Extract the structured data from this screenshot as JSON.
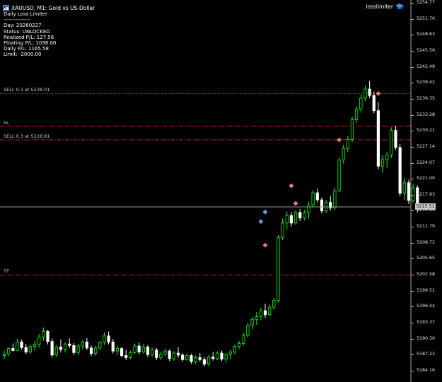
{
  "header": {
    "title": "XAUUSD, M1:  Gold vs US-Dollar",
    "ea_name": "losslimiter"
  },
  "info_panel": {
    "lines": [
      "Daily Loss Limiter",
      "---------------",
      "Day: 20260227",
      "Status: UNLOCKED",
      "Realized P/L: 127.58",
      "Floating P/L: 1038.00",
      "Daily P/L: 1165.58",
      "Limit: -2000.00"
    ]
  },
  "levels": [
    {
      "name": "sell-order-1",
      "label": "SELL 0.3 at 5238.01",
      "price": 5238.01,
      "color": "#2e8b2e",
      "style": "dotted"
    },
    {
      "name": "stop-loss",
      "label": "SL",
      "price": 5231.5,
      "color": "#cc2222",
      "style": "dashdot"
    },
    {
      "name": "sell-order-2",
      "label": "SELL 0.3 at 5228.81",
      "price": 5228.81,
      "color": "#cc2222",
      "style": "dashdot"
    },
    {
      "name": "take-profit",
      "label": "TP",
      "price": 5202.0,
      "color": "#cc2222",
      "style": "dashdot"
    }
  ],
  "bid_line": {
    "price": 5215.51,
    "label": "5215.51"
  },
  "price_axis": {
    "ticks": [
      "5254.77",
      "5251.70",
      "5248.63",
      "5245.56",
      "5242.49",
      "5239.42",
      "5236.35",
      "5233.28",
      "5230.21",
      "5227.14",
      "5224.07",
      "5221.00",
      "5217.93",
      "5214.86",
      "5211.79",
      "5208.72",
      "5205.65",
      "5202.58",
      "5199.51",
      "5196.44",
      "5193.37",
      "5190.30",
      "5187.23",
      "5184.16"
    ]
  },
  "colors": {
    "background": "#000000",
    "bull": "#00ff00",
    "bear": "#ffffff",
    "sell_marker": "#ff6060",
    "buy_marker": "#4a90ff"
  },
  "chart_data": {
    "type": "candlestick",
    "ylim": [
      5183.0,
      5256.0
    ],
    "candles": [
      {
        "o": 5186.0,
        "h": 5187.0,
        "l": 5185.3,
        "c": 5186.3
      },
      {
        "o": 5186.3,
        "h": 5187.6,
        "l": 5185.9,
        "c": 5187.4
      },
      {
        "o": 5187.4,
        "h": 5188.4,
        "l": 5186.8,
        "c": 5187.0
      },
      {
        "o": 5187.0,
        "h": 5189.3,
        "l": 5186.9,
        "c": 5188.7
      },
      {
        "o": 5188.7,
        "h": 5189.2,
        "l": 5187.2,
        "c": 5187.6
      },
      {
        "o": 5187.6,
        "h": 5188.3,
        "l": 5186.3,
        "c": 5186.7
      },
      {
        "o": 5186.7,
        "h": 5188.1,
        "l": 5186.4,
        "c": 5187.8
      },
      {
        "o": 5187.8,
        "h": 5188.9,
        "l": 5187.0,
        "c": 5188.2
      },
      {
        "o": 5188.2,
        "h": 5190.3,
        "l": 5187.6,
        "c": 5189.7
      },
      {
        "o": 5189.7,
        "h": 5191.6,
        "l": 5188.9,
        "c": 5190.8
      },
      {
        "o": 5190.8,
        "h": 5191.1,
        "l": 5188.2,
        "c": 5188.8
      },
      {
        "o": 5188.8,
        "h": 5189.4,
        "l": 5185.6,
        "c": 5186.1
      },
      {
        "o": 5186.1,
        "h": 5188.1,
        "l": 5185.7,
        "c": 5187.7
      },
      {
        "o": 5187.7,
        "h": 5189.2,
        "l": 5186.6,
        "c": 5187.2
      },
      {
        "o": 5187.2,
        "h": 5188.6,
        "l": 5186.6,
        "c": 5188.3
      },
      {
        "o": 5188.3,
        "h": 5189.4,
        "l": 5187.5,
        "c": 5188.0
      },
      {
        "o": 5188.0,
        "h": 5188.5,
        "l": 5186.1,
        "c": 5186.6
      },
      {
        "o": 5186.6,
        "h": 5188.3,
        "l": 5186.0,
        "c": 5187.9
      },
      {
        "o": 5187.9,
        "h": 5189.1,
        "l": 5187.3,
        "c": 5188.7
      },
      {
        "o": 5188.7,
        "h": 5189.5,
        "l": 5187.1,
        "c": 5187.5
      },
      {
        "o": 5187.5,
        "h": 5188.0,
        "l": 5185.9,
        "c": 5186.4
      },
      {
        "o": 5186.4,
        "h": 5187.9,
        "l": 5186.0,
        "c": 5187.5
      },
      {
        "o": 5187.5,
        "h": 5188.9,
        "l": 5187.2,
        "c": 5188.6
      },
      {
        "o": 5188.6,
        "h": 5190.6,
        "l": 5188.1,
        "c": 5189.9
      },
      {
        "o": 5189.9,
        "h": 5190.8,
        "l": 5188.2,
        "c": 5188.7
      },
      {
        "o": 5188.7,
        "h": 5189.3,
        "l": 5186.4,
        "c": 5186.9
      },
      {
        "o": 5186.9,
        "h": 5188.0,
        "l": 5186.1,
        "c": 5187.4
      },
      {
        "o": 5187.4,
        "h": 5187.7,
        "l": 5185.6,
        "c": 5186.0
      },
      {
        "o": 5186.0,
        "h": 5187.2,
        "l": 5185.1,
        "c": 5185.6
      },
      {
        "o": 5185.6,
        "h": 5187.0,
        "l": 5185.3,
        "c": 5186.6
      },
      {
        "o": 5186.6,
        "h": 5188.4,
        "l": 5186.3,
        "c": 5187.9
      },
      {
        "o": 5187.9,
        "h": 5188.6,
        "l": 5186.2,
        "c": 5186.7
      },
      {
        "o": 5186.7,
        "h": 5188.3,
        "l": 5186.4,
        "c": 5187.7
      },
      {
        "o": 5187.7,
        "h": 5188.1,
        "l": 5185.7,
        "c": 5186.2
      },
      {
        "o": 5186.2,
        "h": 5187.6,
        "l": 5185.8,
        "c": 5187.1
      },
      {
        "o": 5187.1,
        "h": 5187.5,
        "l": 5185.1,
        "c": 5185.6
      },
      {
        "o": 5185.6,
        "h": 5186.8,
        "l": 5185.1,
        "c": 5186.3
      },
      {
        "o": 5186.3,
        "h": 5187.4,
        "l": 5185.9,
        "c": 5186.9
      },
      {
        "o": 5186.9,
        "h": 5187.3,
        "l": 5184.9,
        "c": 5185.4
      },
      {
        "o": 5185.4,
        "h": 5186.9,
        "l": 5185.0,
        "c": 5186.5
      },
      {
        "o": 5186.5,
        "h": 5187.7,
        "l": 5185.6,
        "c": 5186.1
      },
      {
        "o": 5186.1,
        "h": 5186.5,
        "l": 5184.8,
        "c": 5185.2
      },
      {
        "o": 5185.2,
        "h": 5186.3,
        "l": 5184.9,
        "c": 5186.0
      },
      {
        "o": 5186.0,
        "h": 5186.4,
        "l": 5184.3,
        "c": 5184.8
      },
      {
        "o": 5184.8,
        "h": 5186.0,
        "l": 5184.3,
        "c": 5185.6
      },
      {
        "o": 5185.6,
        "h": 5186.5,
        "l": 5184.8,
        "c": 5185.2
      },
      {
        "o": 5185.2,
        "h": 5185.7,
        "l": 5183.8,
        "c": 5184.3
      },
      {
        "o": 5184.3,
        "h": 5186.1,
        "l": 5183.9,
        "c": 5185.7
      },
      {
        "o": 5185.7,
        "h": 5186.7,
        "l": 5185.0,
        "c": 5185.4
      },
      {
        "o": 5185.4,
        "h": 5186.9,
        "l": 5185.1,
        "c": 5186.5
      },
      {
        "o": 5186.5,
        "h": 5187.0,
        "l": 5184.9,
        "c": 5185.3
      },
      {
        "o": 5185.3,
        "h": 5186.6,
        "l": 5184.6,
        "c": 5186.2
      },
      {
        "o": 5186.2,
        "h": 5187.1,
        "l": 5185.3,
        "c": 5186.7
      },
      {
        "o": 5186.7,
        "h": 5188.2,
        "l": 5186.2,
        "c": 5187.8
      },
      {
        "o": 5187.8,
        "h": 5188.9,
        "l": 5187.3,
        "c": 5188.4
      },
      {
        "o": 5188.4,
        "h": 5190.5,
        "l": 5188.0,
        "c": 5190.0
      },
      {
        "o": 5190.0,
        "h": 5192.4,
        "l": 5189.6,
        "c": 5192.0
      },
      {
        "o": 5192.0,
        "h": 5193.6,
        "l": 5191.2,
        "c": 5193.2
      },
      {
        "o": 5193.2,
        "h": 5194.6,
        "l": 5192.1,
        "c": 5193.7
      },
      {
        "o": 5193.7,
        "h": 5195.5,
        "l": 5193.1,
        "c": 5194.9
      },
      {
        "o": 5194.9,
        "h": 5196.3,
        "l": 5193.5,
        "c": 5194.1
      },
      {
        "o": 5194.1,
        "h": 5196.1,
        "l": 5193.8,
        "c": 5195.6
      },
      {
        "o": 5195.6,
        "h": 5197.5,
        "l": 5195.1,
        "c": 5196.9
      },
      {
        "o": 5196.9,
        "h": 5209.9,
        "l": 5196.5,
        "c": 5209.4
      },
      {
        "o": 5209.4,
        "h": 5213.2,
        "l": 5208.9,
        "c": 5212.3
      },
      {
        "o": 5212.3,
        "h": 5214.6,
        "l": 5211.0,
        "c": 5213.8
      },
      {
        "o": 5213.8,
        "h": 5214.5,
        "l": 5211.6,
        "c": 5212.3
      },
      {
        "o": 5212.3,
        "h": 5214.9,
        "l": 5211.9,
        "c": 5214.4
      },
      {
        "o": 5214.4,
        "h": 5215.1,
        "l": 5212.7,
        "c": 5213.3
      },
      {
        "o": 5213.3,
        "h": 5214.9,
        "l": 5212.8,
        "c": 5214.3
      },
      {
        "o": 5214.3,
        "h": 5216.5,
        "l": 5213.2,
        "c": 5215.9
      },
      {
        "o": 5215.9,
        "h": 5218.9,
        "l": 5215.4,
        "c": 5218.3
      },
      {
        "o": 5218.3,
        "h": 5219.2,
        "l": 5216.4,
        "c": 5216.9
      },
      {
        "o": 5216.9,
        "h": 5217.4,
        "l": 5214.2,
        "c": 5214.7
      },
      {
        "o": 5214.7,
        "h": 5216.9,
        "l": 5214.3,
        "c": 5216.4
      },
      {
        "o": 5216.4,
        "h": 5217.6,
        "l": 5214.8,
        "c": 5215.3
      },
      {
        "o": 5215.3,
        "h": 5219.3,
        "l": 5214.9,
        "c": 5218.7
      },
      {
        "o": 5218.7,
        "h": 5225.3,
        "l": 5218.4,
        "c": 5224.8
      },
      {
        "o": 5224.8,
        "h": 5227.8,
        "l": 5224.1,
        "c": 5227.1
      },
      {
        "o": 5227.1,
        "h": 5229.6,
        "l": 5226.4,
        "c": 5228.9
      },
      {
        "o": 5228.9,
        "h": 5233.4,
        "l": 5228.4,
        "c": 5232.8
      },
      {
        "o": 5232.8,
        "h": 5235.5,
        "l": 5232.2,
        "c": 5234.9
      },
      {
        "o": 5234.9,
        "h": 5237.8,
        "l": 5234.2,
        "c": 5237.1
      },
      {
        "o": 5237.1,
        "h": 5239.6,
        "l": 5236.5,
        "c": 5238.9
      },
      {
        "o": 5238.9,
        "h": 5240.5,
        "l": 5237.1,
        "c": 5237.6
      },
      {
        "o": 5237.6,
        "h": 5238.4,
        "l": 5234.1,
        "c": 5234.6
      },
      {
        "o": 5234.6,
        "h": 5236.3,
        "l": 5223.0,
        "c": 5223.6
      },
      {
        "o": 5223.6,
        "h": 5225.8,
        "l": 5222.3,
        "c": 5224.9
      },
      {
        "o": 5224.9,
        "h": 5226.5,
        "l": 5223.3,
        "c": 5225.8
      },
      {
        "o": 5225.8,
        "h": 5231.3,
        "l": 5225.2,
        "c": 5230.7
      },
      {
        "o": 5230.7,
        "h": 5231.6,
        "l": 5226.8,
        "c": 5227.3
      },
      {
        "o": 5227.3,
        "h": 5228.0,
        "l": 5217.6,
        "c": 5218.2
      },
      {
        "o": 5218.2,
        "h": 5221.2,
        "l": 5216.9,
        "c": 5220.3
      },
      {
        "o": 5220.3,
        "h": 5220.9,
        "l": 5216.1,
        "c": 5216.8
      },
      {
        "o": 5216.8,
        "h": 5220.1,
        "l": 5216.3,
        "c": 5219.3
      },
      {
        "o": 5219.3,
        "h": 5219.8,
        "l": 5214.4,
        "c": 5215.0
      }
    ],
    "trade_markers": [
      {
        "type": "sell",
        "index": 60,
        "price": 5207.9
      },
      {
        "type": "buy",
        "index": 59,
        "price": 5212.6
      },
      {
        "type": "buy",
        "index": 60,
        "price": 5214.5
      },
      {
        "type": "sell",
        "index": 66,
        "price": 5219.7
      },
      {
        "type": "sell",
        "index": 67,
        "price": 5216.2
      },
      {
        "type": "sell",
        "index": 77,
        "price": 5228.8
      },
      {
        "type": "sell",
        "index": 86,
        "price": 5238.0
      }
    ]
  }
}
